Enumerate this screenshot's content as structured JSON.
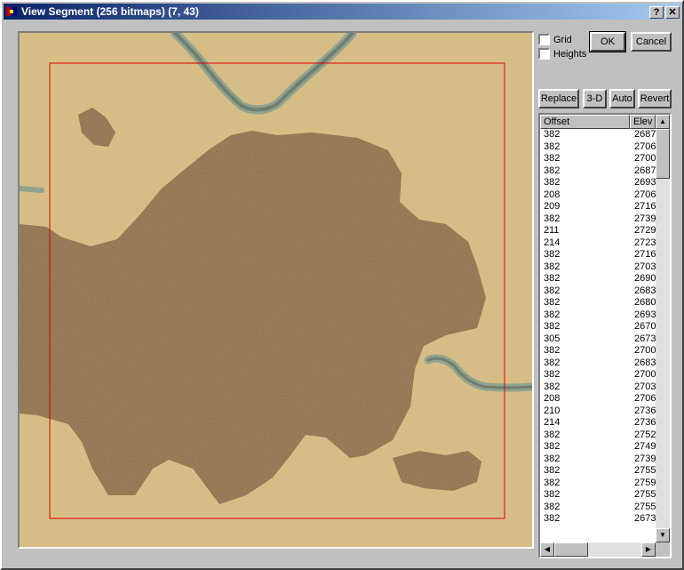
{
  "window": {
    "title": "View Segment (256 bitmaps) (7, 43)",
    "help_label": "?",
    "close_label": "✕"
  },
  "options": {
    "grid_label": "Grid",
    "grid_checked": false,
    "heights_label": "Heights",
    "heights_checked": false
  },
  "buttons": {
    "ok": "OK",
    "cancel": "Cancel",
    "replace": "Replace",
    "three_d": "3-D",
    "auto": "Auto",
    "revert": "Revert"
  },
  "list": {
    "columns": [
      "Offset",
      "Elev"
    ],
    "rows": [
      [
        "382",
        "2687"
      ],
      [
        "382",
        "2706"
      ],
      [
        "382",
        "2700"
      ],
      [
        "382",
        "2687"
      ],
      [
        "382",
        "2693"
      ],
      [
        "208",
        "2706"
      ],
      [
        "209",
        "2716"
      ],
      [
        "382",
        "2739"
      ],
      [
        "211",
        "2729"
      ],
      [
        "214",
        "2723"
      ],
      [
        "382",
        "2716"
      ],
      [
        "382",
        "2703"
      ],
      [
        "382",
        "2690"
      ],
      [
        "382",
        "2683"
      ],
      [
        "382",
        "2680"
      ],
      [
        "382",
        "2693"
      ],
      [
        "382",
        "2670"
      ],
      [
        "305",
        "2673"
      ],
      [
        "382",
        "2700"
      ],
      [
        "382",
        "2683"
      ],
      [
        "382",
        "2700"
      ],
      [
        "382",
        "2703"
      ],
      [
        "208",
        "2706"
      ],
      [
        "210",
        "2736"
      ],
      [
        "214",
        "2736"
      ],
      [
        "382",
        "2752"
      ],
      [
        "382",
        "2749"
      ],
      [
        "382",
        "2739"
      ],
      [
        "382",
        "2755"
      ],
      [
        "382",
        "2759"
      ],
      [
        "382",
        "2755"
      ],
      [
        "382",
        "2755"
      ],
      [
        "382",
        "2673"
      ]
    ]
  },
  "colors": {
    "sand": "#d6bd85",
    "dirt": "#8b6a41",
    "selection": "#e00000",
    "water_edge": "#8fa38f"
  },
  "icons": {
    "app": "app-icon",
    "scroll_up": "arrow-up-icon",
    "scroll_down": "arrow-down-icon",
    "scroll_left": "arrow-left-icon",
    "scroll_right": "arrow-right-icon"
  }
}
